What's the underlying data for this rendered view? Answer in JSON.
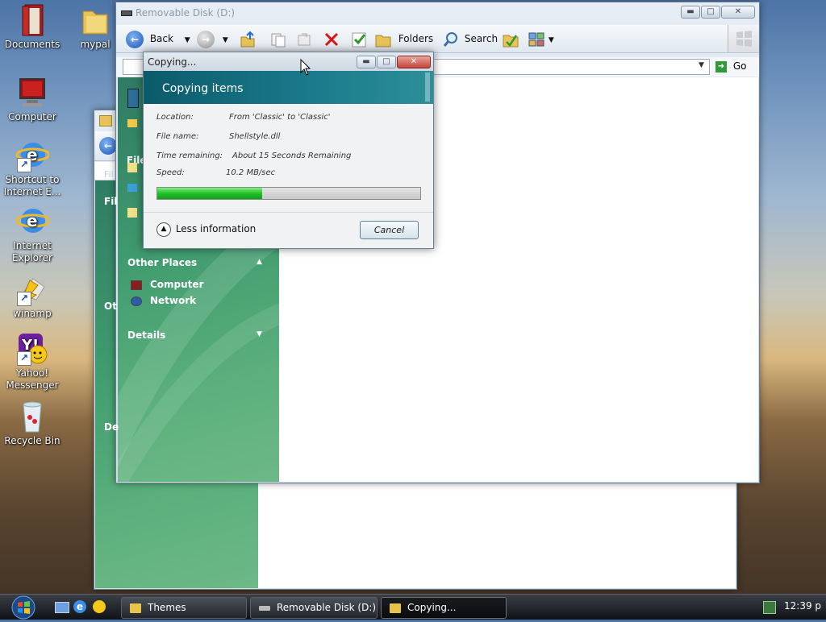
{
  "desktop": {
    "icons": [
      {
        "label": "Documents"
      },
      {
        "label": "mypal"
      },
      {
        "label": "Computer"
      },
      {
        "label": "Shortcut to\nInternet E..."
      },
      {
        "label": "Internet\nExplorer"
      },
      {
        "label": "winamp"
      },
      {
        "label": "Yahoo!\nMessenger"
      },
      {
        "label": "Recycle Bin"
      }
    ]
  },
  "explorer": {
    "title": "Removable Disk (D:)",
    "toolbar": {
      "back": "Back",
      "folders": "Folders",
      "search": "Search"
    },
    "address": {
      "go": "Go"
    },
    "sidebar": {
      "other_places": "Other Places",
      "items": [
        "Computer",
        "Network"
      ],
      "details": "Details"
    }
  },
  "background_window": {
    "partial_labels": [
      "Fil",
      "File",
      "Fil",
      "Ot",
      "De"
    ]
  },
  "copy_dialog": {
    "title": "Copying...",
    "header": "Copying items",
    "location_label": "Location:",
    "location_value": "From 'Classic' to 'Classic'",
    "filename_label": "File name:",
    "filename_value": "Shellstyle.dll",
    "time_label": "Time remaining:",
    "time_value": "About 15 Seconds Remaining",
    "speed_label": "Speed:",
    "speed_value": "10.2 MB/sec",
    "progress_percent": 40,
    "less_info": "Less information",
    "cancel": "Cancel"
  },
  "taskbar": {
    "tasks": [
      "Themes",
      "Removable Disk (D:)",
      "Copying..."
    ],
    "clock": "12:39 p"
  }
}
